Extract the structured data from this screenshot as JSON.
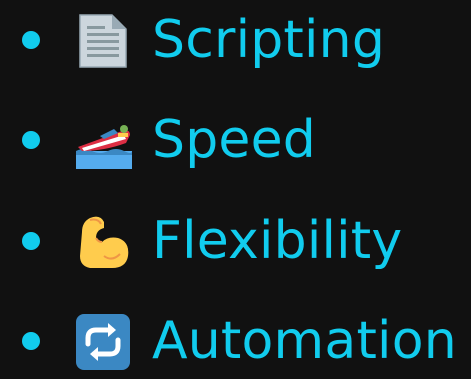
{
  "colors": {
    "background": "#111111",
    "accent": "#11ccee"
  },
  "items": [
    {
      "label": "Scripting",
      "icon": "page-facing-up-icon"
    },
    {
      "label": "Speed",
      "icon": "speedboat-icon"
    },
    {
      "label": "Flexibility",
      "icon": "flexed-biceps-icon"
    },
    {
      "label": "Automation",
      "icon": "repeat-arrows-icon"
    }
  ]
}
